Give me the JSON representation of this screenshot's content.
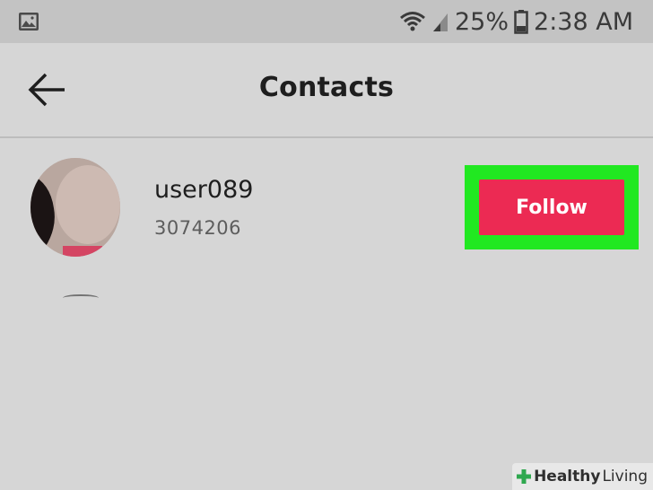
{
  "status_bar": {
    "gallery_icon": "image-icon",
    "wifi_icon": "wifi-icon",
    "signal_icon": "cellular-signal-icon",
    "battery_percent": "25%",
    "battery_icon": "battery-icon",
    "time": "2:38 AM"
  },
  "app_bar": {
    "back_icon": "arrow-left-icon",
    "title": "Contacts"
  },
  "contacts": [
    {
      "username": "user089",
      "subtext": "3074206",
      "follow_label": "Follow"
    }
  ],
  "colors": {
    "follow_button": "#ec2a53",
    "highlight": "#21e821",
    "background": "#d6d6d6",
    "status_bar": "#c3c3c3"
  },
  "watermark": {
    "text_bold": "Healthy",
    "text_regular": "Living"
  }
}
